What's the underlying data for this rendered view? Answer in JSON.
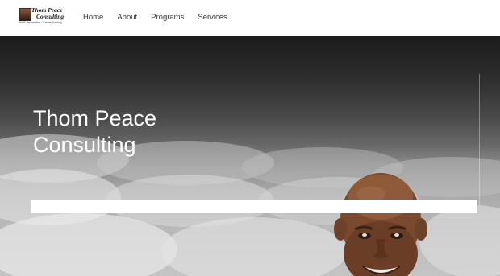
{
  "logo": {
    "title_line1": "Thom Peace",
    "title_line2": "Consulting",
    "tagline": "SWE Preparation • Career Training"
  },
  "nav": {
    "items": [
      "Home",
      "About",
      "Programs",
      "Services"
    ]
  },
  "hero": {
    "title_line1": "Thom Peace",
    "title_line2": "Consulting"
  },
  "colors": {
    "header_bg": "#ffffff",
    "nav_text": "#333333",
    "hero_text": "#ffffff",
    "overlay_bar": "#ffffff"
  }
}
